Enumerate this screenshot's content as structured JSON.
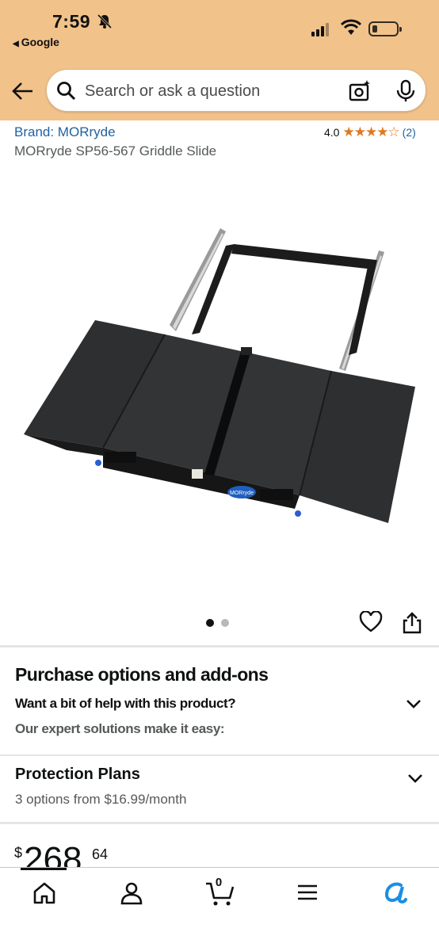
{
  "status": {
    "time": "7:59",
    "back_app": "Google"
  },
  "search": {
    "placeholder": "Search or ask a question"
  },
  "product": {
    "brand": "Brand: MORryde",
    "rating_value": "4.0",
    "rating_stars": 4,
    "stars_display": "★★★★☆",
    "review_count": "(2)",
    "title": "MORryde SP56-567 Griddle Slide",
    "image_logo_text": "MORryde",
    "image_index": 1,
    "image_total": 2
  },
  "purchase": {
    "heading": "Purchase options and add-ons",
    "question": "Want a bit of help with this product?",
    "answer": "Our expert solutions make it easy:"
  },
  "protection": {
    "heading": "Protection Plans",
    "subtitle": "3 options from $16.99/month"
  },
  "price": {
    "symbol": "$",
    "whole": "268",
    "fraction": "64"
  },
  "cart": {
    "count": "0"
  },
  "colors": {
    "header_bg": "#f1c28a",
    "link": "#2162a1",
    "star": "#de7921",
    "rufus": "#1a8fe3"
  }
}
